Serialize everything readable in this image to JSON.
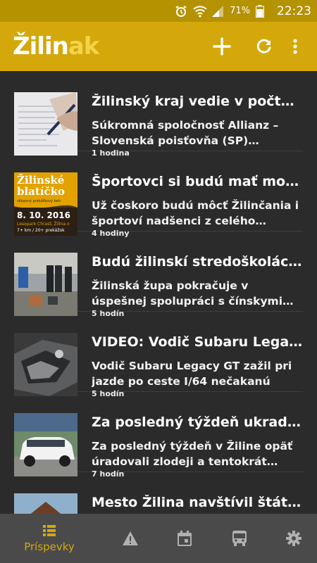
{
  "status": {
    "battery": "71%",
    "time": "22:23"
  },
  "app": {
    "logo_white": "Žilin",
    "logo_yellow": "ak"
  },
  "articles": [
    {
      "title": "Žilinský kraj vedie v počte poistných udalostí",
      "excerpt": "Súkromná spoločnosť Allianz – Slovenská poisťovňa (SP) zverejnila",
      "time": "1 hodina"
    },
    {
      "title": "Športovci si budú mať možnosť zmerať sily",
      "excerpt": "Už čoskoro budú môcť Žilinčania i športoví nadšenci z celého Slovenska",
      "time": "4 hodiny"
    },
    {
      "title": "Budú žilinskí stredoškoláci spolupracovať",
      "excerpt": "Žilinská župa pokračuje v úspešnej spolupráci s čínskymi partnermi a na",
      "time": "5 hodín"
    },
    {
      "title": "VIDEO: Vodič Subaru Legacy GT zažil",
      "excerpt": "Vodič Subaru Legacy GT zažil pri jazde po ceste I/64 nečakanú",
      "time": "5 hodín"
    },
    {
      "title": "Za posledný týždeň ukradli v Žiline",
      "excerpt": "Za posledný týždeň v Žiline opäť úradovali zlodeji a tentokrát zmizli až",
      "time": "7 hodín"
    },
    {
      "title": "Mesto Žilina navštívil štátny radca",
      "excerpt": "",
      "time": ""
    }
  ],
  "thumb2": {
    "line1": "Žilinské",
    "line2": "blatíčko",
    "tagline": "zábavný prekážkový beh",
    "date": "8. 10. 2016",
    "place": "Lesopark Chrasť, Žilina o",
    "extra": "7+ km / 20+ prekážok"
  },
  "nav": {
    "active_label": "Príspevky"
  },
  "colors": {
    "accent": "#d4a80a",
    "statusbar": "#b59200",
    "background": "#2b2b2b",
    "bottomnav": "#4a4a4a"
  }
}
